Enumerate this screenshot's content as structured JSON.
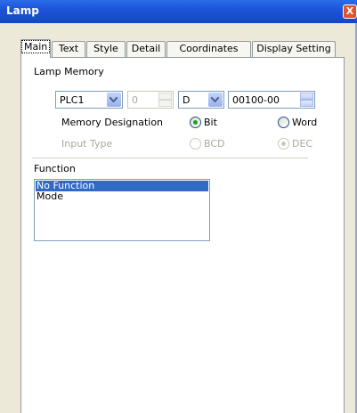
{
  "window": {
    "title": "Lamp",
    "close_label": "X"
  },
  "tabs": [
    "Main",
    "Text",
    "Style",
    "Detail",
    "Coordinates",
    "Display Setting"
  ],
  "lamp_memory": {
    "label": "Lamp Memory",
    "plc": "PLC1",
    "station": "0",
    "device": "D",
    "address": "00100-00"
  },
  "memory_designation": {
    "label": "Memory Designation",
    "options": [
      "Bit",
      "Word"
    ],
    "selected": "Bit"
  },
  "input_type": {
    "label": "Input Type",
    "options": [
      "BCD",
      "DEC"
    ],
    "selected": "DEC",
    "disabled": true
  },
  "function": {
    "label": "Function",
    "items": [
      "No Function",
      "Mode"
    ],
    "selected": "No Function"
  }
}
